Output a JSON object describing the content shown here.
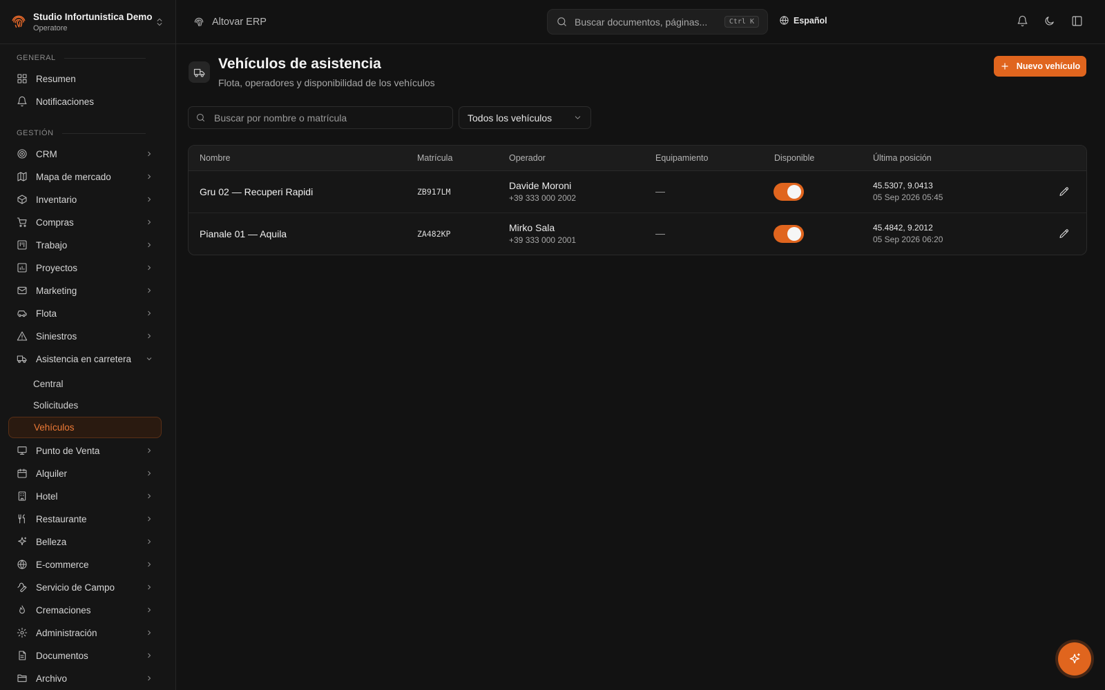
{
  "org": {
    "name": "Studio Infortunistica Demo",
    "role": "Operatore"
  },
  "breadcrumb": {
    "app": "Altovar ERP"
  },
  "global_search": {
    "placeholder": "Buscar documentos, páginas...",
    "shortcut": "Ctrl K"
  },
  "language": "Español",
  "sidebar": {
    "general_label": "GENERAL",
    "general_items": [
      {
        "label": "Resumen",
        "icon": "dashboard-icon"
      },
      {
        "label": "Notificaciones",
        "icon": "bell-icon"
      }
    ],
    "management_label": "GESTIÓN",
    "management_items": [
      {
        "label": "CRM",
        "icon": "target-icon"
      },
      {
        "label": "Mapa de mercado",
        "icon": "map-icon"
      },
      {
        "label": "Inventario",
        "icon": "package-icon"
      },
      {
        "label": "Compras",
        "icon": "cart-icon"
      },
      {
        "label": "Trabajo",
        "icon": "kanban-icon"
      },
      {
        "label": "Proyectos",
        "icon": "chart-icon"
      },
      {
        "label": "Marketing",
        "icon": "mail-icon"
      },
      {
        "label": "Flota",
        "icon": "car-icon"
      },
      {
        "label": "Siniestros",
        "icon": "warning-icon"
      },
      {
        "label": "Asistencia en carretera",
        "icon": "truck-icon"
      }
    ],
    "roadside_subitems": [
      {
        "label": "Central"
      },
      {
        "label": "Solicitudes"
      },
      {
        "label": "Vehículos"
      }
    ],
    "more_items": [
      {
        "label": "Punto de Venta",
        "icon": "monitor-icon"
      },
      {
        "label": "Alquiler",
        "icon": "calendar-icon"
      },
      {
        "label": "Hotel",
        "icon": "building-icon"
      },
      {
        "label": "Restaurante",
        "icon": "utensils-icon"
      },
      {
        "label": "Belleza",
        "icon": "sparkles-icon"
      },
      {
        "label": "E-commerce",
        "icon": "globe-icon"
      },
      {
        "label": "Servicio de Campo",
        "icon": "wrench-icon"
      },
      {
        "label": "Cremaciones",
        "icon": "flame-icon"
      },
      {
        "label": "Administración",
        "icon": "gear-icon"
      },
      {
        "label": "Documentos",
        "icon": "document-icon"
      },
      {
        "label": "Archivo",
        "icon": "folder-icon"
      }
    ]
  },
  "page": {
    "title": "Vehículos de asistencia",
    "subtitle": "Flota, operadores y disponibilidad de los vehículos",
    "new_button": "Nuevo vehículo"
  },
  "filters": {
    "search_placeholder": "Buscar por nombre o matrícula",
    "type_select": "Todos los vehículos"
  },
  "table": {
    "columns": [
      "Nombre",
      "Matrícula",
      "Operador",
      "Equipamiento",
      "Disponible",
      "Última posición"
    ],
    "rows": [
      {
        "name": "Gru 02 — Recuperi Rapidi",
        "plate": "ZB917LM",
        "operator": "Davide Moroni",
        "phone": "+39 333 000 2002",
        "equipment": "—",
        "available": true,
        "coords": "45.5307, 9.0413",
        "date": "05 Sep 2026 05:45"
      },
      {
        "name": "Pianale 01 — Aquila",
        "plate": "ZA482KP",
        "operator": "Mirko Sala",
        "phone": "+39 333 000 2001",
        "equipment": "—",
        "available": true,
        "coords": "45.4842, 9.2012",
        "date": "05 Sep 2026 06:20"
      }
    ]
  },
  "colors": {
    "accent": "#e0651e",
    "background": "#121212",
    "sidebar": "#151515"
  }
}
